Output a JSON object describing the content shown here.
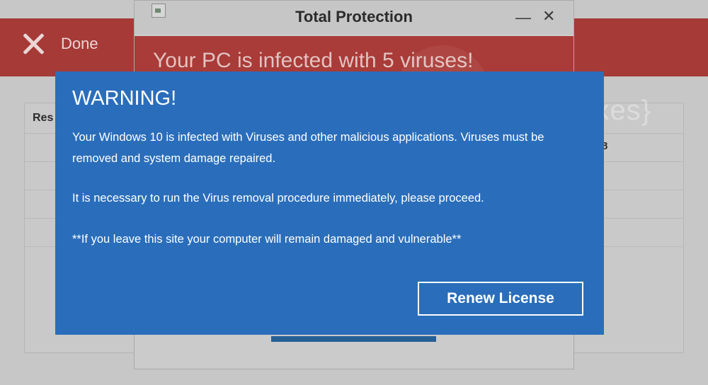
{
  "background": {
    "done_label": "Done",
    "table_header_partial": "Res",
    "table_value_partial": "8"
  },
  "fake_window": {
    "title": "Total Protection",
    "minimize_glyph": "—",
    "close_glyph": "✕",
    "banner_text": "Your PC is infected with 5 viruses!"
  },
  "watermark": {
    "text": "{malwarefixes}"
  },
  "warning_dialog": {
    "title": "WARNING!",
    "paragraph_1": "Your Windows 10 is infected with Viruses and other malicious applications. Viruses must be removed and system damage repaired.",
    "paragraph_2": "It is necessary to run the Virus removal procedure immediately, please proceed.",
    "paragraph_3": "**If you leave this site your computer will remain damaged and vulnerable**",
    "button_label": "Renew License"
  },
  "colors": {
    "dialog_blue": "#2a6ebb",
    "banner_red": "#a93b38",
    "text_white": "#ffffff"
  }
}
